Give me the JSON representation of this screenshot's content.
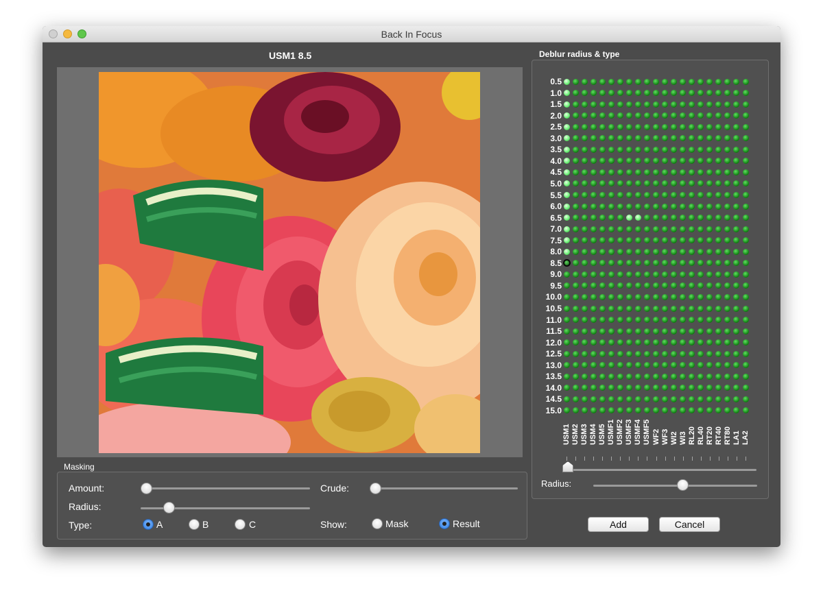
{
  "window": {
    "title": "Back In Focus"
  },
  "preview": {
    "title": "USM1 8.5"
  },
  "masking": {
    "label": "Masking",
    "amount_label": "Amount:",
    "crude_label": "Crude:",
    "radius_label": "Radius:",
    "type_label": "Type:",
    "show_label": "Show:",
    "type_options": [
      "A",
      "B",
      "C"
    ],
    "type_selected": "A",
    "show_options": [
      "Mask",
      "Result"
    ],
    "show_selected": "Result",
    "amount_value": 0.0,
    "crude_value": 0.0,
    "radius_value": 0.16
  },
  "deblur": {
    "label": "Deblur radius & type",
    "radii": [
      "0.5",
      "1.0",
      "1.5",
      "2.0",
      "2.5",
      "3.0",
      "3.5",
      "4.0",
      "4.5",
      "5.0",
      "5.5",
      "6.0",
      "6.5",
      "7.0",
      "7.5",
      "8.0",
      "8.5",
      "9.0",
      "9.5",
      "10.0",
      "10.5",
      "11.0",
      "11.5",
      "12.0",
      "12.5",
      "13.0",
      "13.5",
      "14.0",
      "14.5",
      "15.0"
    ],
    "types": [
      "USM1",
      "USM2",
      "USM3",
      "USM4",
      "USM5",
      "USMF1",
      "USMF2",
      "USMF3",
      "USMF4",
      "USMF5",
      "WF2",
      "WF3",
      "WI2",
      "WI3",
      "RL20",
      "RL40",
      "RT20",
      "RT40",
      "RT80",
      "LA1",
      "LA2"
    ],
    "selected": {
      "radius": "8.5",
      "type": "USM1"
    },
    "highlighted": [
      {
        "radius": "0.5",
        "type": "USM1"
      },
      {
        "radius": "1.0",
        "type": "USM1"
      },
      {
        "radius": "1.5",
        "type": "USM1"
      },
      {
        "radius": "2.0",
        "type": "USM1"
      },
      {
        "radius": "2.5",
        "type": "USM1"
      },
      {
        "radius": "3.0",
        "type": "USM1"
      },
      {
        "radius": "3.5",
        "type": "USM1"
      },
      {
        "radius": "4.0",
        "type": "USM1"
      },
      {
        "radius": "4.5",
        "type": "USM1"
      },
      {
        "radius": "5.0",
        "type": "USM1"
      },
      {
        "radius": "5.5",
        "type": "USM1"
      },
      {
        "radius": "6.0",
        "type": "USM1"
      },
      {
        "radius": "6.5",
        "type": "USM1"
      },
      {
        "radius": "7.0",
        "type": "USM1"
      },
      {
        "radius": "7.5",
        "type": "USM1"
      },
      {
        "radius": "8.0",
        "type": "USM1"
      },
      {
        "radius": "6.5",
        "type": "USMF3"
      },
      {
        "radius": "6.5",
        "type": "USMF4"
      }
    ],
    "radius_label": "Radius:",
    "type_slider_value": 0.0,
    "radius_slider_value": 0.55
  },
  "buttons": {
    "add": "Add",
    "cancel": "Cancel"
  }
}
